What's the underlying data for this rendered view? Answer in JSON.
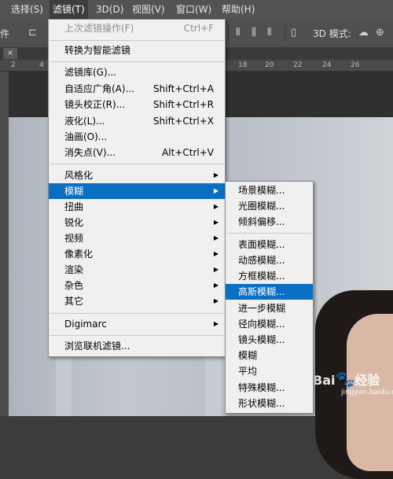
{
  "menubar": {
    "items": [
      "选择(S)",
      "滤镜(T)",
      "3D(D)",
      "视图(V)",
      "窗口(W)",
      "帮助(H)"
    ],
    "active_index": 1
  },
  "optionsbar": {
    "left_fragment": "件",
    "mode_label": "3D 模式:"
  },
  "tab": {
    "close_icon": "×"
  },
  "ruler": {
    "marks": [
      "2",
      "4",
      "18",
      "20",
      "22",
      "24",
      "26"
    ]
  },
  "filter_menu": {
    "last_filter": {
      "label": "上次滤镜操作(F)",
      "shortcut": "Ctrl+F"
    },
    "smart_filters": "转换为智能滤镜",
    "group1": [
      {
        "label": "滤镜库(G)...",
        "shortcut": ""
      },
      {
        "label": "自适应广角(A)...",
        "shortcut": "Shift+Ctrl+A"
      },
      {
        "label": "镜头校正(R)...",
        "shortcut": "Shift+Ctrl+R"
      },
      {
        "label": "液化(L)...",
        "shortcut": "Shift+Ctrl+X"
      },
      {
        "label": "油画(O)...",
        "shortcut": ""
      },
      {
        "label": "消失点(V)...",
        "shortcut": "Alt+Ctrl+V"
      }
    ],
    "categories": [
      "风格化",
      "模糊",
      "扭曲",
      "锐化",
      "视频",
      "像素化",
      "渲染",
      "杂色",
      "其它"
    ],
    "highlighted_category": "模糊",
    "digimarc": "Digimarc",
    "browse_online": "浏览联机滤镜..."
  },
  "blur_submenu": {
    "group1": [
      "场景模糊...",
      "光圈模糊...",
      "倾斜偏移..."
    ],
    "group2": [
      "表面模糊...",
      "动感模糊...",
      "方框模糊...",
      "高斯模糊...",
      "进一步模糊",
      "径向模糊...",
      "镜头模糊...",
      "模糊",
      "平均",
      "特殊模糊...",
      "形状模糊..."
    ],
    "highlighted": "高斯模糊..."
  },
  "watermark": {
    "brand": "Bai",
    "brand_cn": "经验",
    "url": "jingyan.baidu.com"
  }
}
